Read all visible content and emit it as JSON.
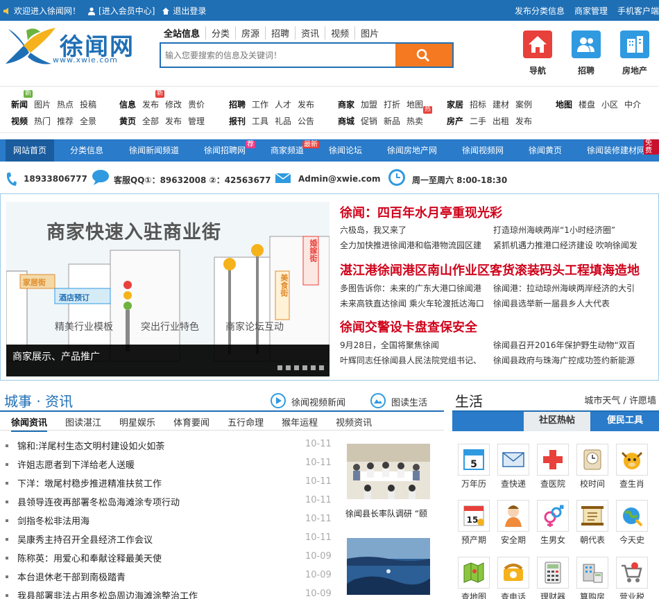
{
  "topbar": {
    "welcome": "欢迎进入徐闻网！",
    "member": "[进入会员中心]",
    "logout": "退出登录",
    "links": [
      "发布分类信息",
      "商家管理",
      "手机客户端"
    ]
  },
  "logo": {
    "name": "徐闻网",
    "url": "www.xwie.com"
  },
  "search": {
    "tabs": [
      "全站信息",
      "分类",
      "房源",
      "招聘",
      "资讯",
      "视频",
      "图片"
    ],
    "placeholder": "输入您要搜索的信息及关键词！"
  },
  "header_icons": [
    {
      "label": "导航",
      "icon": "home-icon",
      "color": "#e8403b"
    },
    {
      "label": "招聘",
      "icon": "users-icon",
      "color": "#2f9ae0"
    },
    {
      "label": "房地产",
      "icon": "building-icon",
      "color": "#2f9ae0"
    }
  ],
  "categories": [
    {
      "row1": [
        "新闻",
        "图片",
        "热点",
        "投稿"
      ],
      "row2": [
        "视频",
        "热门",
        "推荐",
        "全景"
      ]
    },
    {
      "row1": [
        "信息",
        "发布",
        "修改",
        "贵价"
      ],
      "row2": [
        "黄页",
        "全部",
        "发布",
        "管理"
      ]
    },
    {
      "row1": [
        "招聘",
        "工作",
        "人才",
        "发布"
      ],
      "row2": [
        "报刊",
        "工具",
        "礼品",
        "公告"
      ]
    },
    {
      "row1": [
        "商家",
        "加盟",
        "打折",
        "地图"
      ],
      "row2": [
        "商城",
        "促销",
        "新品",
        "热卖"
      ]
    },
    {
      "row1": [
        "家居",
        "招标",
        "建材",
        "案例"
      ],
      "row2": [
        "房产",
        "二手",
        "出租",
        "发布"
      ]
    },
    {
      "row1": [
        "地图",
        "楼盘",
        "小区",
        "中介"
      ],
      "row2": []
    }
  ],
  "badges": {
    "new": "新",
    "hot": "热"
  },
  "nav": {
    "items": [
      "网站首页",
      "分类信息",
      "徐闻新闻频道",
      "徐闻招聘网",
      "商家频道",
      "徐闻论坛",
      "徐闻房地产网",
      "徐闻视频网",
      "徐闻黄页",
      "徐闻装修建材网"
    ],
    "badge_jian": "荐",
    "badge_new": "最新",
    "badge_rec": "免费"
  },
  "contact": {
    "phone": "18933806777",
    "qq": "客服QQ①：89632008 ②：42563677",
    "email": "Admin@xwie.com",
    "hours": "周一至周六 8:00-18:30"
  },
  "banner": {
    "headline": "商家快速入驻商业街",
    "features": [
      "精美行业模板",
      "突出行业特色",
      "商家论坛互动"
    ],
    "caption": "商家展示、产品推广",
    "sign1": "家居街",
    "sign2": "酒店预订",
    "sign3": "婚嫁街",
    "sign4": "美食街"
  },
  "headlines": [
    {
      "title": "徐闻：四百年水月亭重现光彩",
      "links": [
        "六极岛，我又来了",
        "打造琼州海峡两岸“1小时经济圈”",
        "全力加快推进徐闻港和临港物流园区建",
        "紧抓机遇力推港口经济建设 吹响徐闻发"
      ]
    },
    {
      "title": "湛江港徐闻港区南山作业区客货滚装码头工程填海造地",
      "links": [
        "多图告诉你：未来的广东大港口徐闻港",
        "徐闻港：拉动琼州海峡两岸经济的大引",
        "未来高铁直达徐闻 乘火车轮渡抵达海口",
        "徐闻县选举新一届县乡人大代表"
      ]
    },
    {
      "title": "徐闻交警设卡盘查保安全",
      "links": [
        "9月28日，全国将聚焦徐闻",
        "徐闻县召开2016年保护野生动物“双百",
        "叶辉同志任徐闻县人民法院党组书记、",
        "徐闻县政府与珠海广控成功签约新能源"
      ]
    }
  ],
  "city": {
    "title": "城事 · 资讯",
    "video_link": "徐闻视频新闻",
    "photo_link": "图读生活",
    "tabs": [
      "徐闻资讯",
      "图读湛江",
      "明星娱乐",
      "体育要闻",
      "五行命理",
      "猴年运程",
      "视频资讯"
    ],
    "news": [
      {
        "title": "锦和:洋尾村生态文明村建设如火如荼",
        "date": "10-11"
      },
      {
        "title": "许姐志愿者到下洋给老人送暖",
        "date": "10-11"
      },
      {
        "title": "下洋：墩尾村稳步推进精准扶贫工作",
        "date": "10-11"
      },
      {
        "title": "县领导连夜再部署冬松岛海滩涂专项行动",
        "date": "10-11"
      },
      {
        "title": "剑指冬松非法用海",
        "date": "10-11"
      },
      {
        "title": "吴康秀主持召开全县经济工作会议",
        "date": "10-11"
      },
      {
        "title": "陈称英：用爱心和奉献诠释最美天使",
        "date": "10-09"
      },
      {
        "title": "本台退休老干部到南极踏青",
        "date": "10-09"
      },
      {
        "title": "我县部署非法占用冬松岛周边海滩涂整治工作",
        "date": "10-09"
      }
    ],
    "photo_caption": "徐闻县长率队调研 “颐"
  },
  "life": {
    "title": "生活",
    "links": "城市天气 / 许愿墙",
    "tabs": [
      "社区热帖",
      "便民工具"
    ],
    "tools": [
      {
        "label": "万年历",
        "icon": "calendar-icon"
      },
      {
        "label": "查快递",
        "icon": "mail-icon"
      },
      {
        "label": "查医院",
        "icon": "hospital-icon"
      },
      {
        "label": "校时间",
        "icon": "clock-icon"
      },
      {
        "label": "查生肖",
        "icon": "zodiac-icon"
      },
      {
        "label": "预产期",
        "icon": "due-date-icon"
      },
      {
        "label": "安全期",
        "icon": "nurse-icon"
      },
      {
        "label": "生男女",
        "icon": "gender-icon"
      },
      {
        "label": "朝代表",
        "icon": "scroll-icon"
      },
      {
        "label": "今天史",
        "icon": "globe-icon"
      },
      {
        "label": "查地图",
        "icon": "map-icon"
      },
      {
        "label": "查电话",
        "icon": "phone-icon"
      },
      {
        "label": "理财器",
        "icon": "calculator-icon"
      },
      {
        "label": "算购房",
        "icon": "house-calc-icon"
      },
      {
        "label": "营业税",
        "icon": "cart-icon"
      }
    ],
    "calendar_day": "5",
    "due_day": "15"
  }
}
